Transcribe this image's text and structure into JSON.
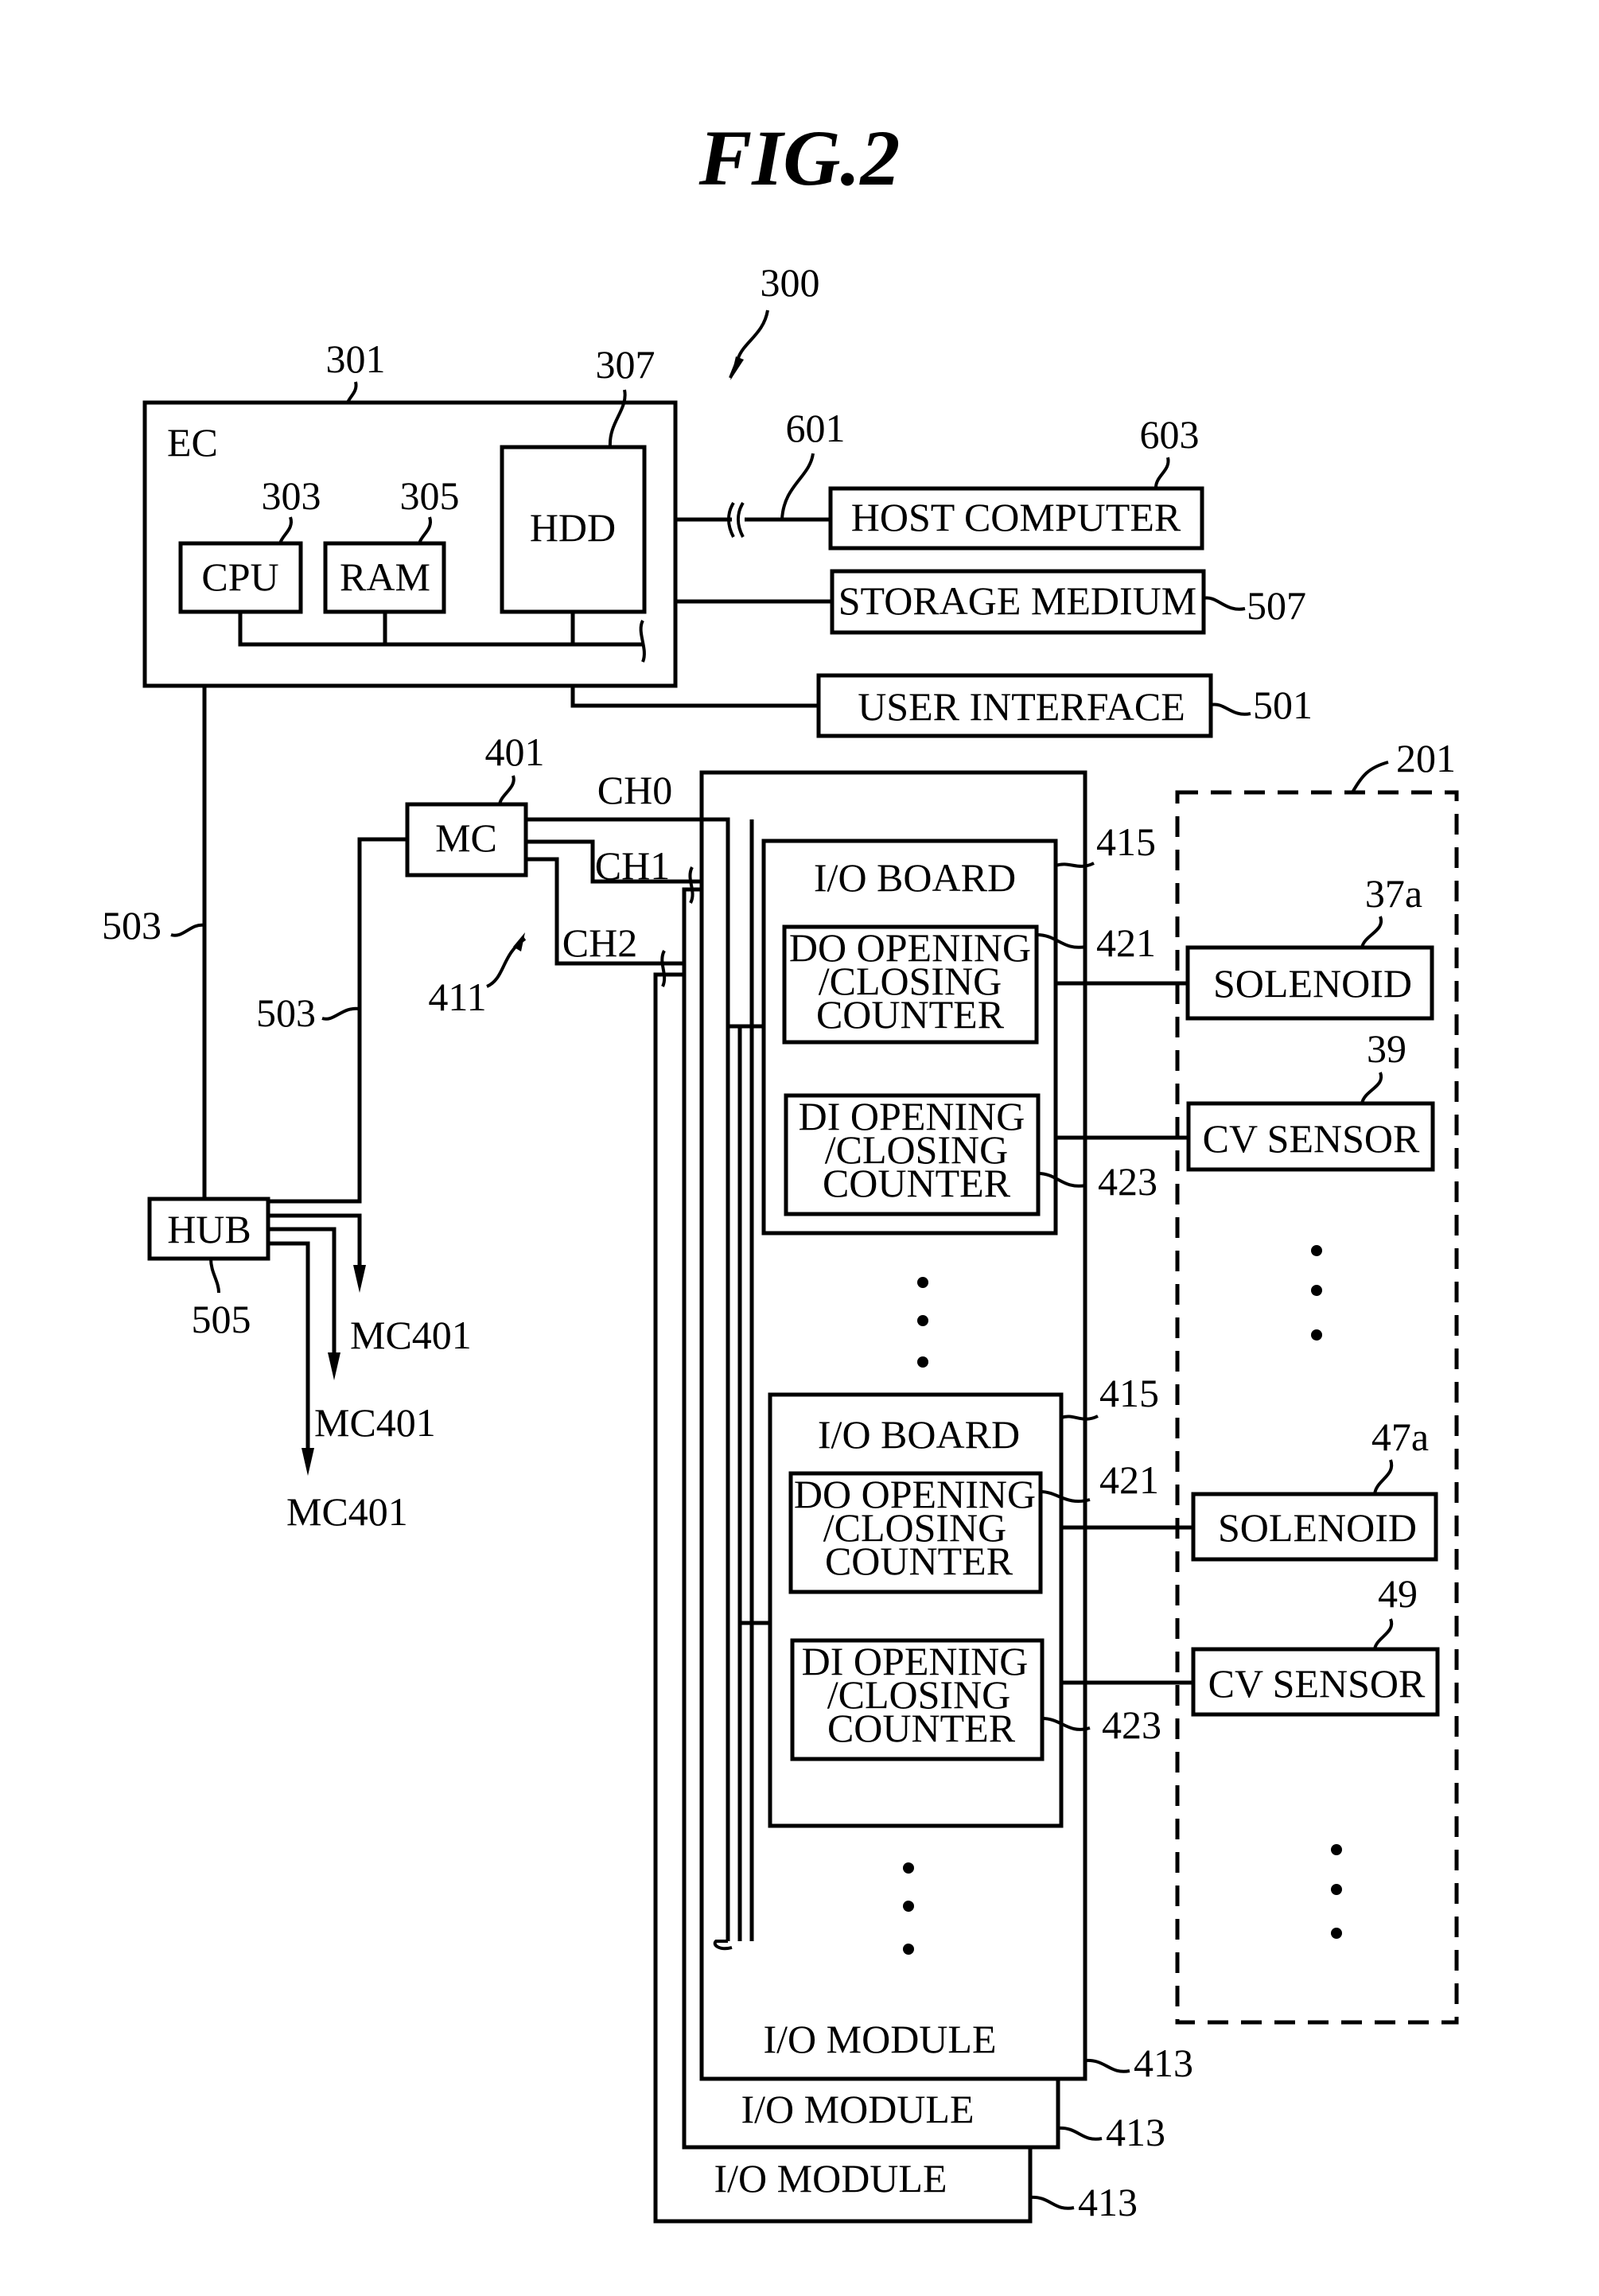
{
  "figure": {
    "title": "FIG.2",
    "system_ref": "300"
  },
  "ec": {
    "label": "EC",
    "ref": "301",
    "cpu": {
      "label": "CPU",
      "ref": "303"
    },
    "ram": {
      "label": "RAM",
      "ref": "305"
    },
    "hdd": {
      "label": "HDD",
      "ref": "307"
    }
  },
  "external": {
    "network_ref": "601",
    "host_computer": {
      "label": "HOST COMPUTER",
      "ref": "603"
    },
    "storage_medium": {
      "label": "STORAGE MEDIUM",
      "ref": "507"
    },
    "user_interface": {
      "label": "USER INTERFACE",
      "ref": "501"
    }
  },
  "network": {
    "line_ref_1": "503",
    "line_ref_2": "503",
    "hub": {
      "label": "HUB",
      "ref": "505"
    },
    "hub_outputs": [
      "MC401",
      "MC401",
      "MC401"
    ]
  },
  "mc": {
    "label": "MC",
    "ref": "401",
    "channels": [
      "CH0",
      "CH1",
      "CH2"
    ],
    "channel_group_ref": "411"
  },
  "io_modules": [
    {
      "label": "I/O MODULE",
      "ref": "413"
    },
    {
      "label": "I/O MODULE",
      "ref": "413"
    },
    {
      "label": "I/O MODULE",
      "ref": "413"
    }
  ],
  "io_boards": [
    {
      "label": "I/O BOARD",
      "ref": "415",
      "do_counter": {
        "lines": [
          "DO OPENING",
          "/CLOSING",
          "COUNTER"
        ],
        "ref": "421"
      },
      "di_counter": {
        "lines": [
          "DI OPENING",
          "/CLOSING",
          "COUNTER"
        ],
        "ref": "423"
      }
    },
    {
      "label": "I/O BOARD",
      "ref": "415",
      "do_counter": {
        "lines": [
          "DO OPENING",
          "/CLOSING",
          "COUNTER"
        ],
        "ref": "421"
      },
      "di_counter": {
        "lines": [
          "DI OPENING",
          "/CLOSING",
          "COUNTER"
        ],
        "ref": "423"
      }
    }
  ],
  "equipment": {
    "ref": "201",
    "devices": [
      {
        "label": "SOLENOID",
        "ref": "37a"
      },
      {
        "label": "CV SENSOR",
        "ref": "39"
      },
      {
        "label": "SOLENOID",
        "ref": "47a"
      },
      {
        "label": "CV SENSOR",
        "ref": "49"
      }
    ]
  }
}
